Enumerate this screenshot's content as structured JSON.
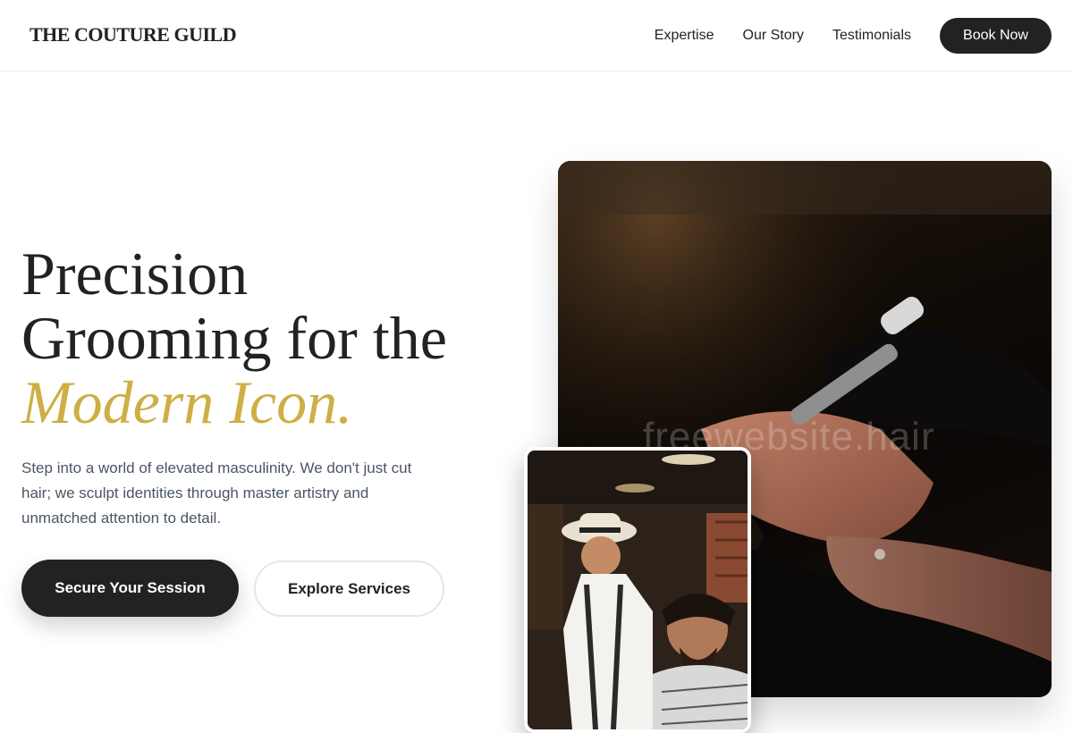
{
  "brand": {
    "name": "THE COUTURE GUILD"
  },
  "nav": {
    "items": [
      {
        "label": "Expertise"
      },
      {
        "label": "Our Story"
      },
      {
        "label": "Testimonials"
      }
    ],
    "cta_label": "Book Now"
  },
  "hero": {
    "title_line1": "Precision",
    "title_line2": "Grooming for the",
    "title_accent": "Modern Icon.",
    "description": "Step into a world of elevated masculinity. We don't just cut hair; we sculpt identities through master artistry and unmatched attention to detail.",
    "primary_button": "Secure Your Session",
    "secondary_button": "Explore Services"
  },
  "images": {
    "main_watermark": "freewebsite.hair",
    "main_icon": "barber-shaving-photo",
    "secondary_icon": "barber-haircut-photo"
  },
  "colors": {
    "accent": "#cfae45",
    "primary": "#222222",
    "body_text": "#4a5565"
  }
}
